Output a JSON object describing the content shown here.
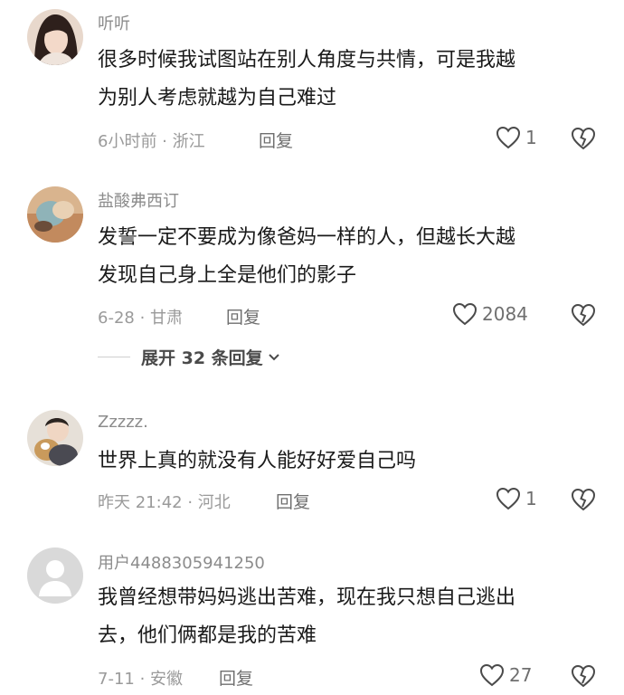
{
  "comments": [
    {
      "username": "听听",
      "lines": [
        "很多时候我试图站在别人角度与共情，可是我越",
        "为别人考虑就越为自己难过"
      ],
      "time_location": "6小时前 · 浙江",
      "reply_label": "回复",
      "likes": "1",
      "avatar_color": "#3b2a26"
    },
    {
      "username": "盐酸弗西订",
      "lines": [
        "发誓一定不要成为像爸妈一样的人，但越长大越",
        "发现自己身上全是他们的影子"
      ],
      "time_location": "6-28 · 甘肃",
      "reply_label": "回复",
      "likes": "2084",
      "avatar_color": "#c9a07a"
    },
    {
      "username": "Zzzzz.",
      "lines": [
        "世界上真的就没有人能好好爱自己吗"
      ],
      "time_location": "昨天 21:42 · 河北",
      "reply_label": "回复",
      "likes": "1",
      "avatar_color": "#b8a992"
    },
    {
      "username": "用户4488305941250",
      "lines": [
        "我曾经想带妈妈逃出苦难，现在我只想自己逃出",
        "去，他们俩都是我的苦难"
      ],
      "time_location": "7-11 · 安徽",
      "reply_label": "回复",
      "likes": "27",
      "avatar_color": "#d9d9d9"
    }
  ],
  "expand_replies": "展开 32 条回复",
  "icons": {
    "like": "heart-outline-icon",
    "dislike": "broken-heart-icon",
    "expand": "chevron-down-icon",
    "default_avatar": "default-user-avatar-icon"
  }
}
